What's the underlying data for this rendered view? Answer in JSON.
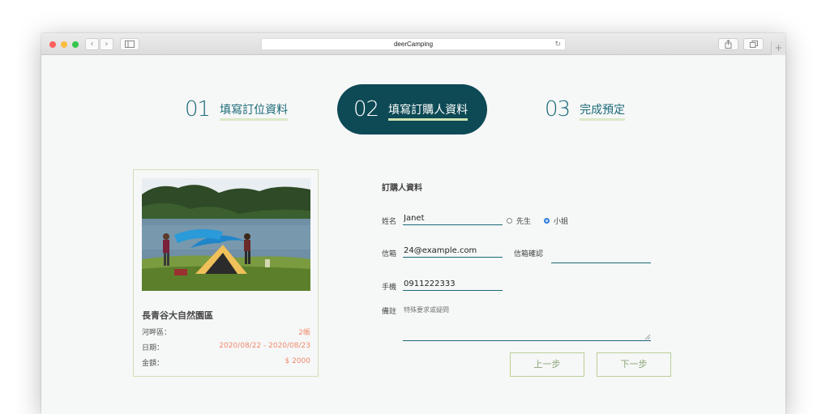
{
  "browser": {
    "url": "deerCamping",
    "reload_icon": "↻",
    "back_icon": "‹",
    "forward_icon": "›",
    "plus_icon": "+"
  },
  "steps": [
    {
      "num": "01",
      "label": "填寫訂位資料",
      "active": false
    },
    {
      "num": "02",
      "label": "填寫訂購人資料",
      "active": true
    },
    {
      "num": "03",
      "label": "完成預定",
      "active": false
    }
  ],
  "card": {
    "title": "長青谷大自然園區",
    "rows": [
      {
        "label": "河畔區：",
        "value": "2帳"
      },
      {
        "label": "日期：",
        "value": "2020/08/22 - 2020/08/23"
      },
      {
        "label": "金額：",
        "value": "$ 2000"
      }
    ]
  },
  "form": {
    "heading": "訂購人資料",
    "name_label": "姓名",
    "name_value": "Janet",
    "gender_options": [
      {
        "label": "先生",
        "selected": false
      },
      {
        "label": "小姐",
        "selected": true
      }
    ],
    "email_label": "信箱",
    "email_value": "24@example.com",
    "email_confirm_label": "信箱確認",
    "email_confirm_value": "",
    "phone_label": "手機",
    "phone_value": "0911222333",
    "note_label": "備註",
    "note_placeholder": "特殊要求或疑問"
  },
  "buttons": {
    "prev": "上一步",
    "next": "下一步"
  },
  "colors": {
    "accent": "#0d4a55",
    "teal": "#1b6a78",
    "highlight": "#f08a6c",
    "border_green": "#b9d196"
  }
}
